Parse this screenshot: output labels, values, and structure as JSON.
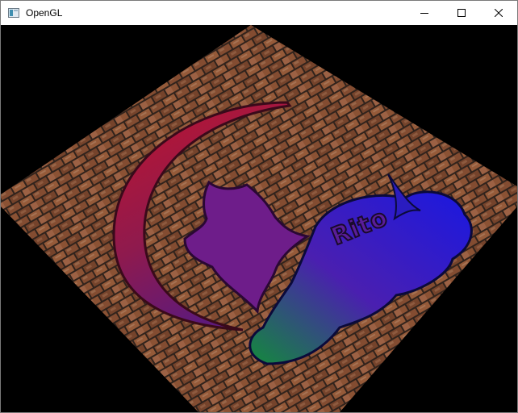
{
  "window": {
    "title": "OpenGL",
    "icon": "opengl-app-icon",
    "controls": {
      "minimize": "minimize-icon",
      "maximize": "maximize-icon",
      "close": "close-icon"
    }
  },
  "scene": {
    "background_color": "#000000",
    "surface_texture": "brick-wall",
    "decal_text": "Rito",
    "decal_gradient": [
      "#b3122e",
      "#6a1a8a",
      "#2e1fd6",
      "#1e8a3a"
    ]
  }
}
